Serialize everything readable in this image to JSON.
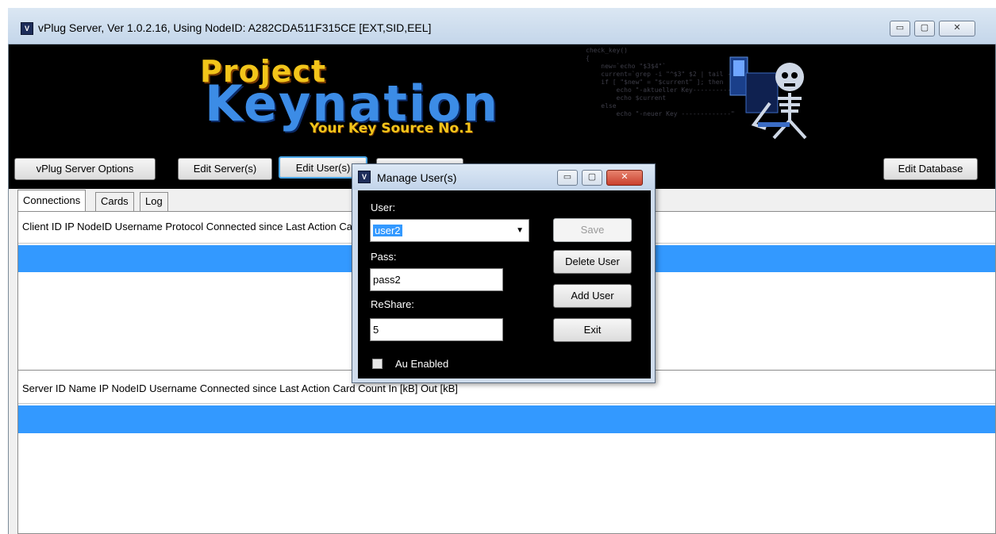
{
  "window": {
    "title": "vPlug Server,  Ver 1.0.2.16, Using NodeID: A282CDA511F315CE [EXT,SID,EEL]",
    "controls": {
      "minimize": "▭",
      "maximize": "▢",
      "close": "✕"
    }
  },
  "banner": {
    "logo_line1": "Project",
    "logo_line2": "Keynation",
    "tagline": "Your Key Source No.1",
    "code_lines": "check_key()\n{\n    new=`echo \"$3$4\"`\n    current=`grep -i \"^$3\" $2 | tail -1`\n    if [ \"$new\" = \"$current\" ]; then\n        echo \"-aktueller Key----------\"\n        echo $current\n    else\n        echo \"-neuer Key -------------\""
  },
  "toolbar": {
    "vplug_options": "vPlug Server Options",
    "edit_servers": "Edit Server(s)",
    "edit_users": "Edit User(s)",
    "edit_database": "Edit Database"
  },
  "tabs": [
    "Connections",
    "Cards",
    "Log"
  ],
  "connections_table": {
    "header": "Client ID  IP  NodeID  Username  Protocol  Connected since  Last Action  Card Count  In [kB]  Out [kB]"
  },
  "servers_table": {
    "header": "Server ID  Name  IP  NodeID  Username  Connected since  Last Action  Card Count  In [kB]  Out [kB]"
  },
  "dialog": {
    "title": "Manage User(s)",
    "user_label": "User:",
    "user_value": "user2",
    "pass_label": "Pass:",
    "pass_value": "pass2",
    "reshare_label": "ReShare:",
    "reshare_value": "5",
    "au_label": "Au Enabled",
    "au_checked": false,
    "save": "Save",
    "delete_user": "Delete User",
    "add_user": "Add User",
    "exit": "Exit"
  },
  "colors": {
    "selection": "#3399ff",
    "close_button": "#c9402e"
  }
}
